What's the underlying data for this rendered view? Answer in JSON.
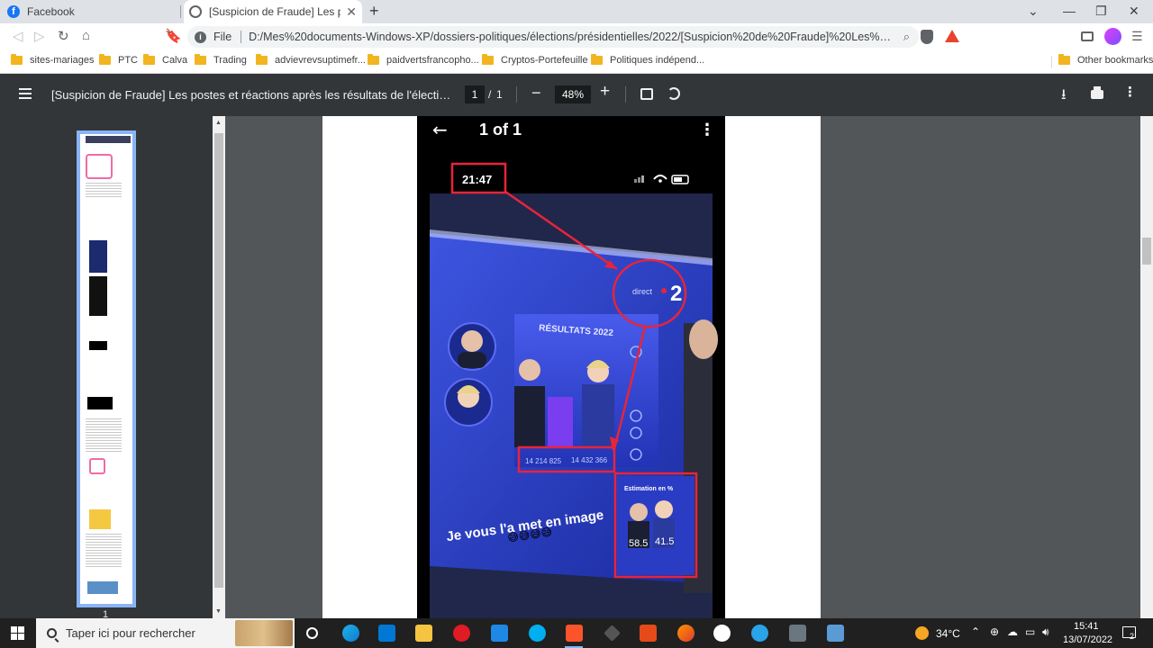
{
  "tabs": [
    {
      "title": "Facebook"
    },
    {
      "title": "[Suspicion de Fraude] Les postes et"
    }
  ],
  "address": {
    "scheme": "File",
    "url": "D:/Mes%20documents-Windows-XP/dossiers-politiques/élections/présidentielles/2022/[Suspicion%20de%20Fraude]%20Les%20postes%..."
  },
  "bookmarks": [
    {
      "label": "sites-mariages"
    },
    {
      "label": "PTC"
    },
    {
      "label": "Calva"
    },
    {
      "label": "Trading"
    },
    {
      "label": "advievrevsuptimefr..."
    },
    {
      "label": "paidvertsfrancopho..."
    },
    {
      "label": "Cryptos-Portefeuille"
    },
    {
      "label": "Politiques indépend..."
    }
  ],
  "other_bookmarks": "Other bookmarks",
  "pdf": {
    "title": "[Suspicion de Fraude] Les postes et réactions après les résultats de l'élection prés...",
    "page_current": "1",
    "page_sep": "/",
    "page_total": "1",
    "zoom": "48%",
    "thumb_number": "1"
  },
  "phone": {
    "header": "1 of 1",
    "back_glyph": "←",
    "more_glyph": "⋮",
    "time": "21:47",
    "channel": "direct",
    "channel_num": "2",
    "results_title": "RÉSULTATS 2022",
    "vote_left": "14 214 825",
    "vote_right": "14 432 366",
    "estimation_label": "Estimation en %",
    "pct_left": "58.5",
    "pct_right": "41.5",
    "caption": "Je vous l'a met en image",
    "emojis": "😅😅😅😅"
  },
  "taskbar": {
    "search_placeholder": "Taper ici pour rechercher",
    "temperature": "34°C",
    "time": "15:41",
    "date": "13/07/2022",
    "notif_count": "2"
  },
  "colors": {
    "accent_red": "#e8243a",
    "thumb_border": "#8ab4f8",
    "tv_blue": "#2340c7"
  }
}
